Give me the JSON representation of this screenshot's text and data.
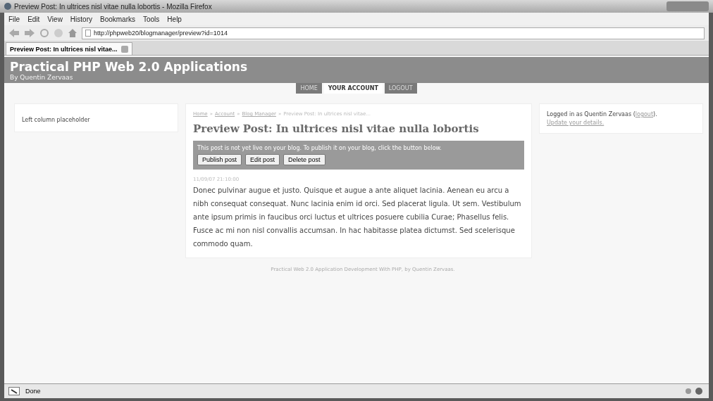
{
  "window": {
    "title": "Preview Post: In ultrices nisl vitae nulla lobortis - Mozilla Firefox"
  },
  "menu": [
    "File",
    "Edit",
    "View",
    "History",
    "Bookmarks",
    "Tools",
    "Help"
  ],
  "address": {
    "value": "http://phpweb20/blogmanager/preview?id=1014"
  },
  "tabs": [
    {
      "label": "Preview Post: In ultrices nisl vitae...",
      "selected": true
    }
  ],
  "site": {
    "title": "Practical PHP Web 2.0 Applications",
    "subtitle": "By Quentin Zervaas"
  },
  "nav": [
    {
      "label": "HOME",
      "selected": false
    },
    {
      "label": "YOUR ACCOUNT",
      "selected": true
    },
    {
      "label": "LOGOUT",
      "selected": false
    }
  ],
  "left_column": {
    "text": "Left column placeholder"
  },
  "breadcrumbs": [
    {
      "label": "Home",
      "kind": "link"
    },
    {
      "label": "Account",
      "kind": "link"
    },
    {
      "label": "Blog Manager",
      "kind": "link"
    },
    {
      "label": "Preview Post: In ultrices nisl vitae...",
      "kind": "current"
    }
  ],
  "breadcrumb_separator": "»",
  "heading": "Preview Post: In ultrices nisl vitae nulla lobortis",
  "notice": {
    "text": "This post is not yet live on your blog. To publish it on your blog, click the button below.",
    "buttons": [
      "Publish post",
      "Edit post",
      "Delete post"
    ]
  },
  "post": {
    "date": "11/09/07 21:10:00",
    "body": "Donec pulvinar augue et justo. Quisque et augue a ante aliquet lacinia. Aenean eu arcu a nibh consequat consequat. Nunc lacinia enim id orci. Sed placerat ligula. Ut sem. Vestibulum ante ipsum primis in faucibus orci luctus et ultrices posuere cubilia Curae; Phasellus felis. Fusce ac mi non nisl convallis accumsan. In hac habitasse platea dictumst. Sed scelerisque commodo quam."
  },
  "right_column": {
    "before": "Logged in as Quentin Zervaas (",
    "link": "logout",
    "after": ").",
    "details_link": "Update your details."
  },
  "footer": "Practical Web 2.0 Application Development With PHP, by Quentin Zervaas.",
  "status_bar": {
    "text": "Done"
  }
}
